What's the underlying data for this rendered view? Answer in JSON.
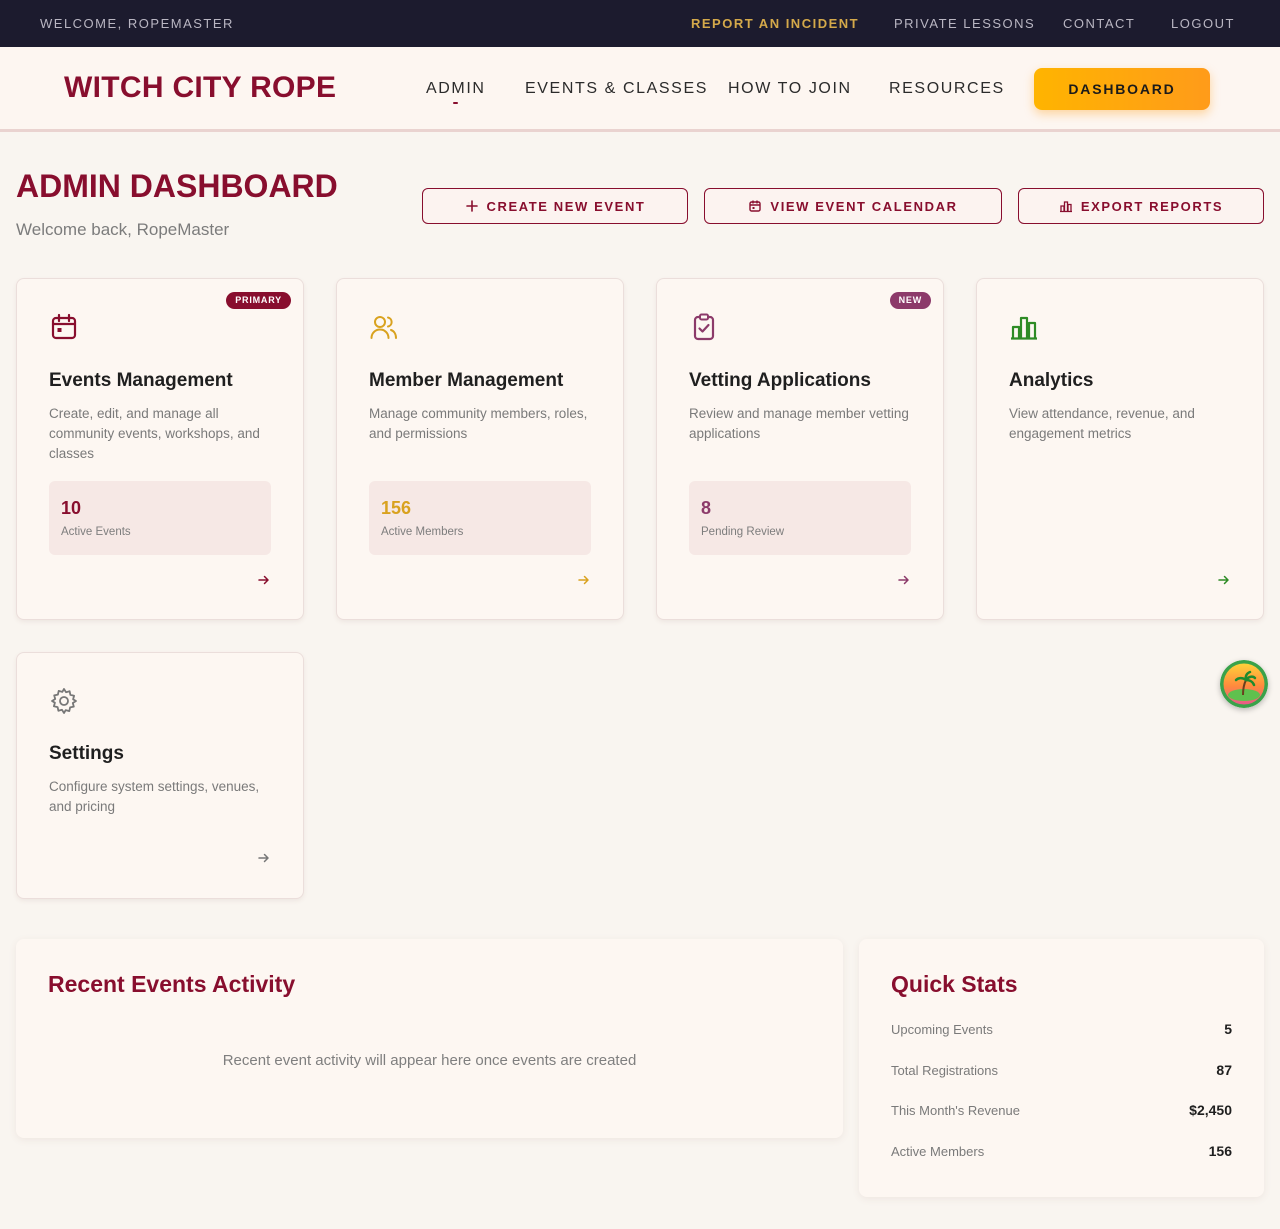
{
  "utility": {
    "welcome": "WELCOME, ROPEMASTER",
    "links": [
      "REPORT AN INCIDENT",
      "PRIVATE LESSONS",
      "CONTACT",
      "LOGOUT"
    ]
  },
  "header": {
    "brand": "WITCH CITY ROPE",
    "nav": [
      "ADMIN",
      "EVENTS & CLASSES",
      "HOW TO JOIN",
      "RESOURCES"
    ],
    "cta": "DASHBOARD"
  },
  "page": {
    "title": "ADMIN DASHBOARD",
    "subtitle": "Welcome back, RopeMaster",
    "actions": [
      "CREATE NEW EVENT",
      "VIEW EVENT CALENDAR",
      "EXPORT REPORTS"
    ]
  },
  "cards": [
    {
      "title": "Events Management",
      "desc": "Create, edit, and manage all community events, workshops, and classes",
      "badge": "PRIMARY",
      "stat_value": "10",
      "stat_label": "Active Events",
      "icon": "calendar-icon",
      "color": "#880e2e"
    },
    {
      "title": "Member Management",
      "desc": "Manage community members, roles, and permissions",
      "stat_value": "156",
      "stat_label": "Active Members",
      "icon": "users-icon",
      "color": "#d9a21f"
    },
    {
      "title": "Vetting Applications",
      "desc": "Review and manage member vetting applications",
      "badge": "NEW",
      "stat_value": "8",
      "stat_label": "Pending Review",
      "icon": "clipboard-check-icon",
      "color": "#8c3a6a"
    },
    {
      "title": "Analytics",
      "desc": "View attendance, revenue, and engagement metrics",
      "icon": "bar-chart-icon",
      "color": "#2e8b25"
    },
    {
      "title": "Settings",
      "desc": "Configure system settings, venues, and pricing",
      "icon": "gear-icon",
      "color": "#777777"
    }
  ],
  "recent": {
    "title": "Recent Events Activity",
    "empty": "Recent event activity will appear here once events are created"
  },
  "quick_stats": {
    "title": "Quick Stats",
    "rows": [
      {
        "label": "Upcoming Events",
        "value": "5"
      },
      {
        "label": "Total Registrations",
        "value": "87"
      },
      {
        "label": "This Month's Revenue",
        "value": "$2,450"
      },
      {
        "label": "Active Members",
        "value": "156"
      }
    ]
  }
}
